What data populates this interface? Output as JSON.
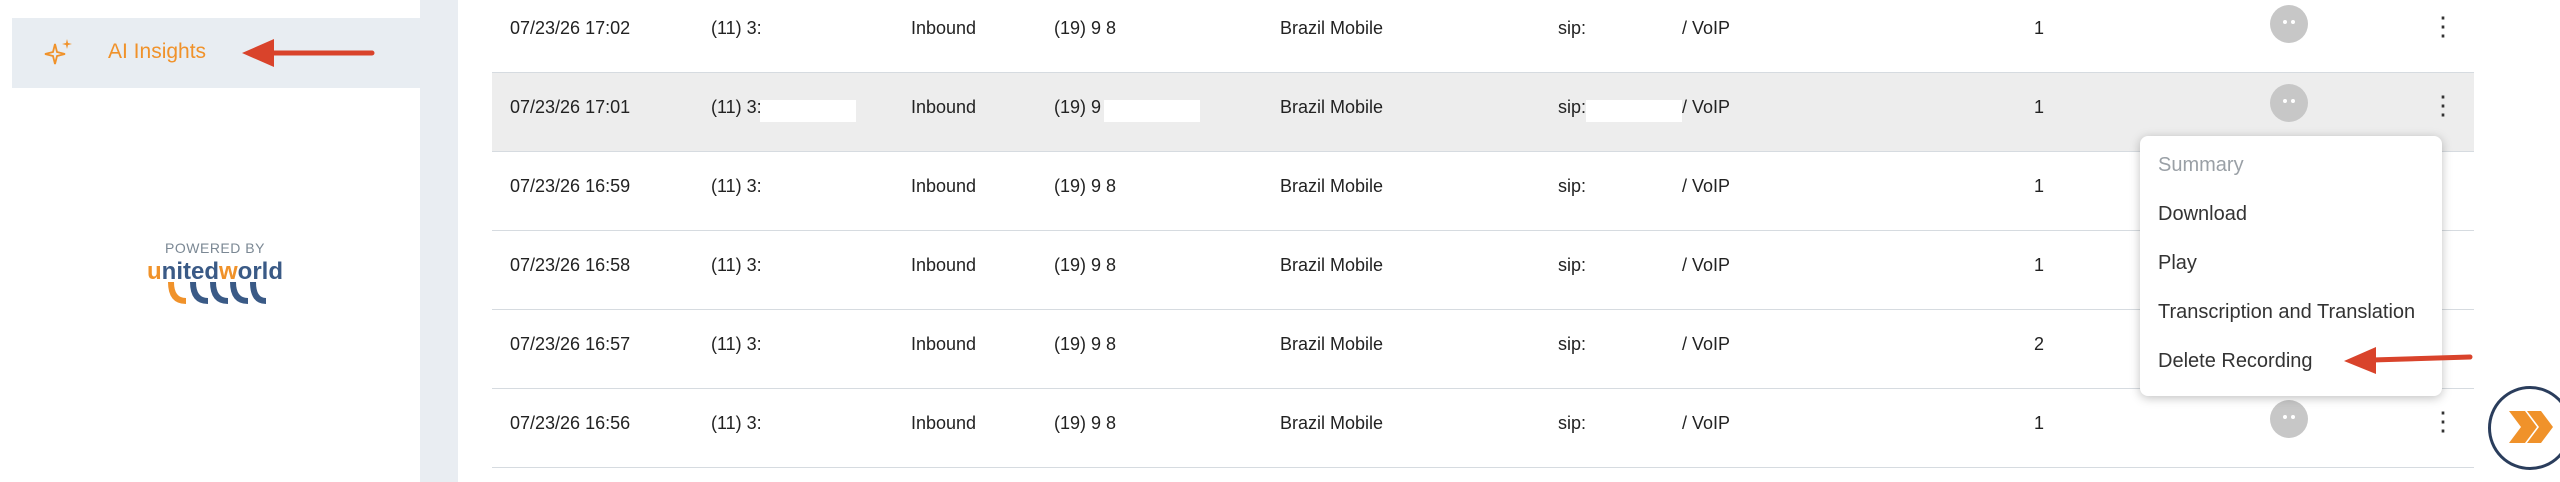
{
  "sidebar": {
    "ai_insights_label": "AI Insights",
    "powered_by": "POWERED BY",
    "logo": {
      "part1": "u",
      "part2": "nited",
      "part3": "w",
      "part4": "orld"
    }
  },
  "rows": [
    {
      "date": "07/23/26 17:02",
      "from": "(11) 3:",
      "direction": "Inbound",
      "to": "(19) 9 8",
      "carrier": "Brazil Mobile",
      "sip": "sip:",
      "type": "/ VoIP",
      "count": "1"
    },
    {
      "date": "07/23/26 17:01",
      "from": "(11) 3:",
      "direction": "Inbound",
      "to": "(19) 9 8",
      "carrier": "Brazil Mobile",
      "sip": "sip:",
      "type": "/ VoIP",
      "count": "1"
    },
    {
      "date": "07/23/26 16:59",
      "from": "(11) 3:",
      "direction": "Inbound",
      "to": "(19) 9 8",
      "carrier": "Brazil Mobile",
      "sip": "sip:",
      "type": "/ VoIP",
      "count": "1"
    },
    {
      "date": "07/23/26 16:58",
      "from": "(11) 3:",
      "direction": "Inbound",
      "to": "(19) 9 8",
      "carrier": "Brazil Mobile",
      "sip": "sip:",
      "type": "/ VoIP",
      "count": "1"
    },
    {
      "date": "07/23/26 16:57",
      "from": "(11) 3:",
      "direction": "Inbound",
      "to": "(19) 9 8",
      "carrier": "Brazil Mobile",
      "sip": "sip:",
      "type": "/ VoIP",
      "count": "2"
    },
    {
      "date": "07/23/26 16:56",
      "from": "(11) 3:",
      "direction": "Inbound",
      "to": "(19) 9 8",
      "carrier": "Brazil Mobile",
      "sip": "sip:",
      "type": "/ VoIP",
      "count": "1"
    }
  ],
  "kebab_glyph": "⋮",
  "context_menu": {
    "items": [
      "Summary",
      "Download",
      "Play",
      "Transcription and Translation",
      "Delete Recording"
    ]
  },
  "colors": {
    "accent_orange": "#f0922a",
    "annotation_red": "#d9432b",
    "navy": "#2a3d5c",
    "logo_blue": "#3a5a86"
  },
  "icons": {
    "ai": "sparkle-icon",
    "row_avatar": "avatar-icon",
    "row_menu": "kebab-menu-icon",
    "fab": "double-chevron-right-icon"
  }
}
